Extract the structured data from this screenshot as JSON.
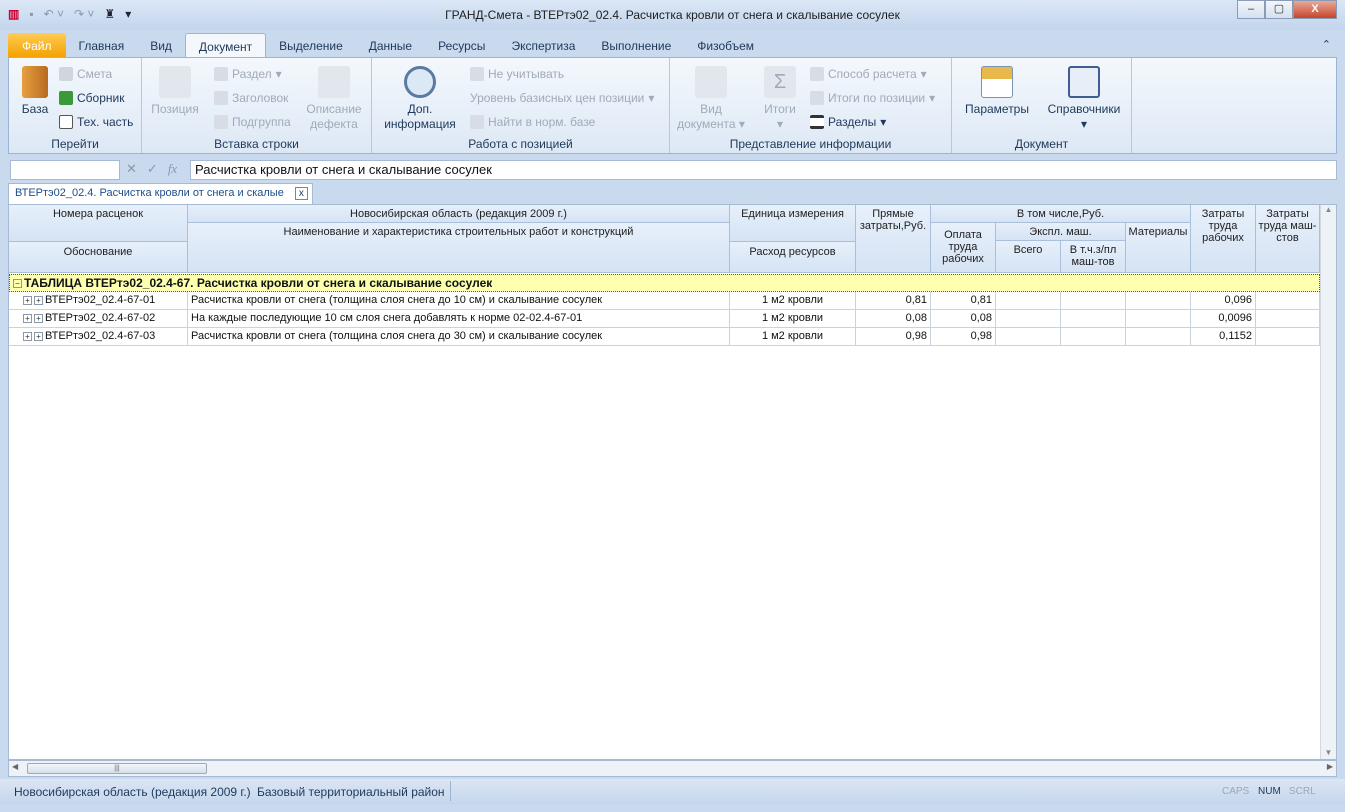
{
  "window": {
    "title": "ГРАНД-Смета - ВТЕРтэ02_02.4. Расчистка кровли от снега и скалывание сосулек",
    "minimize": "–",
    "maximize": "▢",
    "close": "X"
  },
  "tabs": [
    "Файл",
    "Главная",
    "Вид",
    "Документ",
    "Выделение",
    "Данные",
    "Ресурсы",
    "Экспертиза",
    "Выполнение",
    "Физобъем"
  ],
  "ribbon": {
    "go": {
      "label": "Перейти",
      "baza": "База",
      "smeta": "Смета",
      "sbornik": "Сборник",
      "tech": "Тех. часть"
    },
    "insert": {
      "label": "Вставка строки",
      "pozitsiya": "Позиция",
      "razdel": "Раздел",
      "zagolovok": "Заголовок",
      "podgruppa": "Подгруппа",
      "opisanie": "Описание",
      "defekta": "дефекта"
    },
    "work": {
      "label": "Работа с позицией",
      "dop": "Доп.",
      "info": "информация",
      "ne_uchit": "Не учитывать",
      "uroven": "Уровень базисных цен позиции",
      "nayti": "Найти в норм. базе"
    },
    "view": {
      "label": "Представление информации",
      "vid": "Вид",
      "dokumenta": "документа",
      "itogi": "Итоги",
      "sposob": "Способ расчета",
      "itogi_poz": "Итоги по позиции",
      "razdely": "Разделы"
    },
    "doc": {
      "label": "Документ",
      "parametry": "Параметры",
      "spravochniki": "Справочники"
    }
  },
  "formula": {
    "name_value": "",
    "value": "Расчистка кровли от снега и скалывание сосулек"
  },
  "doc_tab": {
    "label": "ВТЕРтэ02_02.4. Расчистка кровли от снега и скалые"
  },
  "table": {
    "headers": {
      "nomera": "Номера расценок",
      "obosn": "Обоснование",
      "region": "Новосибирская область (редакция 2009 г.)",
      "naim": "Наименование и характеристика строительных работ и конструкций",
      "ed": "Единица измерения",
      "rashod": "Расход ресурсов",
      "pryamye": "Прямые затраты,Руб.",
      "vtom": "В том числе,Руб.",
      "oplata": "Оплата труда рабочих",
      "ekspl": "Экспл. маш.",
      "vsego": "Всего",
      "vtch": "В т.ч.з/пл маш-тов",
      "materialy": "Материалы",
      "zatr_rab": "Затраты труда рабочих",
      "zatr_mash": "Затраты труда маш-стов"
    },
    "group": "ТАБЛИЦА ВТЕРтэ02_02.4-67. Расчистка кровли от снега и скалывание сосулек",
    "rows": [
      {
        "code": "ВТЕРтэ02_02.4-67-01",
        "name": "Расчистка кровли от снега (толщина слоя снега до 10 см) и скалывание сосулек",
        "unit": "1 м2 кровли",
        "direct": "0,81",
        "labor": "0,81",
        "mach": "",
        "mach_wage": "",
        "materials": "",
        "labor_cost": "0,096",
        "mach_cost": ""
      },
      {
        "code": "ВТЕРтэ02_02.4-67-02",
        "name": "На каждые последующие 10 см слоя снега добавлять к   норме 02-02.4-67-01",
        "unit": "1 м2 кровли",
        "direct": "0,08",
        "labor": "0,08",
        "mach": "",
        "mach_wage": "",
        "materials": "",
        "labor_cost": "0,0096",
        "mach_cost": ""
      },
      {
        "code": "ВТЕРтэ02_02.4-67-03",
        "name": "Расчистка кровли от снега (толщина слоя снега до 30 см) и скалывание сосулек",
        "unit": "1 м2 кровли",
        "direct": "0,98",
        "labor": "0,98",
        "mach": "",
        "mach_wage": "",
        "materials": "",
        "labor_cost": "0,1152",
        "mach_cost": ""
      }
    ]
  },
  "status": {
    "region": "Новосибирская область (редакция 2009 г.)",
    "district": "Базовый территориальный район",
    "caps": "CAPS",
    "num": "NUM",
    "scrl": "SCRL"
  }
}
